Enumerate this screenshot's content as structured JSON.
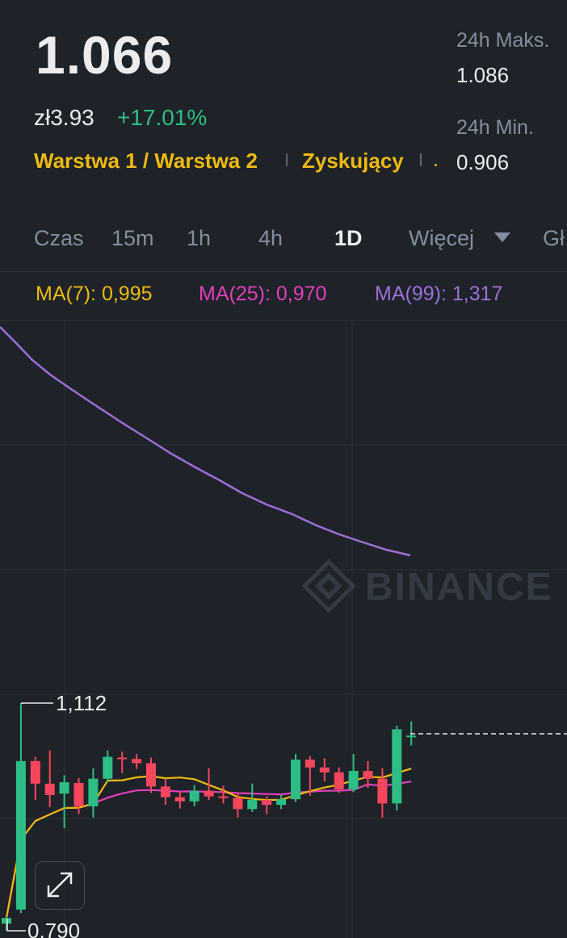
{
  "ticker": {
    "price": "1.066",
    "fiat_price": "zł3.93",
    "change_pct": "+17.01%",
    "tags": [
      "Warstwa 1 / Warstwa 2",
      "Zyskujący"
    ],
    "stats": {
      "high_label": "24h Maks.",
      "high_value": "1.086",
      "low_label": "24h Min.",
      "low_value": "0.906"
    }
  },
  "timeframes": {
    "items": [
      "Czas",
      "15m",
      "1h",
      "4h",
      "1D",
      "Więcej",
      "Gł"
    ],
    "active": "1D"
  },
  "indicators": {
    "ma7": "MA(7): 0,995",
    "ma25": "MA(25): 0,970",
    "ma99": "MA(99): 1,317"
  },
  "colors": {
    "up": "#2ebd85",
    "down": "#f6465d",
    "ma7": "#f0b90b",
    "ma25": "#e040bb",
    "ma99": "#9d6fd6",
    "tag": "#f0b90b",
    "background": "#1e2329"
  },
  "chart_data": {
    "type": "candlestick",
    "annotations": {
      "high": "1,112",
      "low": "0,790"
    },
    "watermark": "BINANCE",
    "current_price": 1.066,
    "candles": [
      {
        "o": 0.8,
        "h": 0.81,
        "l": 0.79,
        "c": 0.808
      },
      {
        "o": 0.82,
        "h": 1.112,
        "l": 0.815,
        "c": 1.03
      },
      {
        "o": 1.03,
        "h": 1.036,
        "l": 0.975,
        "c": 0.998
      },
      {
        "o": 0.998,
        "h": 1.045,
        "l": 0.965,
        "c": 0.982
      },
      {
        "o": 0.984,
        "h": 1.01,
        "l": 0.935,
        "c": 1.0
      },
      {
        "o": 0.999,
        "h": 1.006,
        "l": 0.955,
        "c": 0.966
      },
      {
        "o": 0.966,
        "h": 1.02,
        "l": 0.95,
        "c": 1.005
      },
      {
        "o": 1.005,
        "h": 1.045,
        "l": 1.0,
        "c": 1.036
      },
      {
        "o": 1.035,
        "h": 1.043,
        "l": 1.013,
        "c": 1.033
      },
      {
        "o": 1.033,
        "h": 1.04,
        "l": 1.019,
        "c": 1.027
      },
      {
        "o": 1.027,
        "h": 1.035,
        "l": 0.985,
        "c": 0.994
      },
      {
        "o": 0.994,
        "h": 1.005,
        "l": 0.968,
        "c": 0.979
      },
      {
        "o": 0.979,
        "h": 0.986,
        "l": 0.963,
        "c": 0.973
      },
      {
        "o": 0.973,
        "h": 0.996,
        "l": 0.966,
        "c": 0.988
      },
      {
        "o": 0.988,
        "h": 1.02,
        "l": 0.975,
        "c": 0.98
      },
      {
        "o": 0.98,
        "h": 0.995,
        "l": 0.97,
        "c": 0.978
      },
      {
        "o": 0.978,
        "h": 0.985,
        "l": 0.95,
        "c": 0.962
      },
      {
        "o": 0.962,
        "h": 0.998,
        "l": 0.958,
        "c": 0.975
      },
      {
        "o": 0.975,
        "h": 0.98,
        "l": 0.955,
        "c": 0.968
      },
      {
        "o": 0.968,
        "h": 0.982,
        "l": 0.962,
        "c": 0.976
      },
      {
        "o": 0.976,
        "h": 1.04,
        "l": 0.972,
        "c": 1.032
      },
      {
        "o": 1.032,
        "h": 1.037,
        "l": 0.981,
        "c": 1.021
      },
      {
        "o": 1.021,
        "h": 1.034,
        "l": 1.001,
        "c": 1.014
      },
      {
        "o": 1.014,
        "h": 1.021,
        "l": 0.985,
        "c": 0.99
      },
      {
        "o": 0.99,
        "h": 1.04,
        "l": 0.986,
        "c": 1.016
      },
      {
        "o": 1.016,
        "h": 1.03,
        "l": 0.992,
        "c": 1.005
      },
      {
        "o": 1.005,
        "h": 1.02,
        "l": 0.95,
        "c": 0.97
      },
      {
        "o": 0.97,
        "h": 1.08,
        "l": 0.96,
        "c": 1.075
      },
      {
        "o": 1.066,
        "h": 1.086,
        "l": 1.052,
        "c": 1.066
      }
    ]
  }
}
